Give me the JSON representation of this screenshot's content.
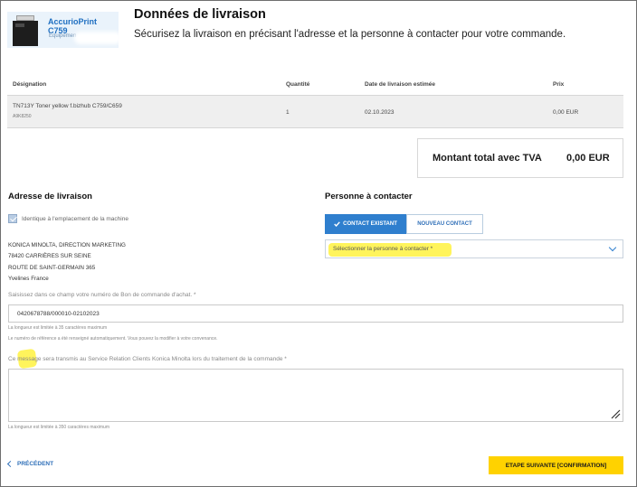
{
  "product": {
    "name": "AccurioPrint C759",
    "subtitle": "Equipemen"
  },
  "header": {
    "title": "Données de livraison",
    "subtitle": "Sécurisez la livraison en précisant l'adresse et la personne à contacter pour votre commande."
  },
  "table": {
    "headers": [
      "Désignation",
      "Quantité",
      "Date de livraison estimée",
      "Prix"
    ],
    "rows": [
      {
        "designation": "TN713Y Toner yellow f.bizhub C759/C659",
        "sku": "A9K8250",
        "quantity": "1",
        "date": "02.10.2023",
        "price": "0,00 EUR"
      }
    ]
  },
  "total": {
    "label": "Montant total avec TVA",
    "value": "0,00 EUR"
  },
  "delivery": {
    "title": "Adresse de livraison",
    "same_as_machine_label": "Identique à l'emplacement de la machine",
    "address_lines": [
      "KONICA MINOLTA, DIRECTION MARKETING",
      "78420 CARRIÈRES SUR SEINE",
      "ROUTE DE SAINT-GERMAIN 365",
      "Yvelines France"
    ],
    "po_label": "Saisissez dans ce champ votre numéro de Bon de commande d'achat. *",
    "po_value": "0420678788/000010-02102023",
    "po_limit": "La longueur est limitée à 35 caractères maximum",
    "po_note": "Le numéro de référence a été renseigné automatiquement. Vous pouvez la modifier à votre convenance.",
    "message_label": "Ce message sera transmis au Service Relation Clients Konica Minolta lors du traitement de la commande *",
    "message_value": "",
    "message_limit": "La longueur est limitée à 350 caractères maximum"
  },
  "contact": {
    "title": "Personne à contacter",
    "tab_existing": "CONTACT EXISTANT",
    "tab_new": "NOUVEAU CONTACT",
    "select_placeholder": "Sélectionner la personne à contacter *"
  },
  "footer": {
    "prev_label": "PRÉCÉDENT",
    "next_label": "ETAPE SUIVANTE [CONFIRMATION]"
  },
  "colors": {
    "accent_blue": "#2f7fce",
    "primary_yellow": "#ffd200",
    "highlight": "#fff45c"
  }
}
